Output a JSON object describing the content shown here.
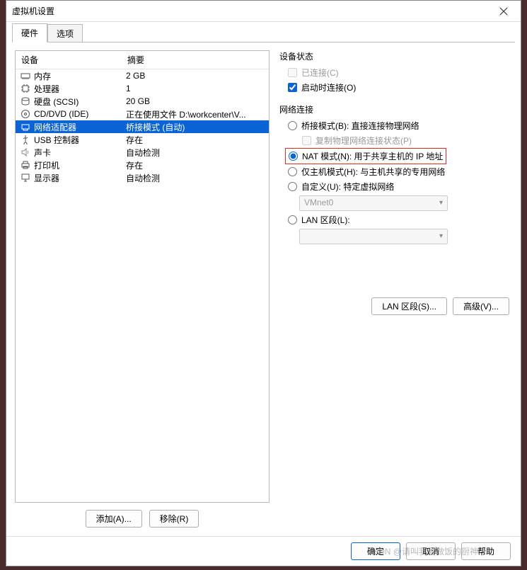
{
  "title": "虚拟机设置",
  "tabs": {
    "hardware": "硬件",
    "options": "选项"
  },
  "hw_header": {
    "device": "设备",
    "summary": "摘要"
  },
  "devices": [
    {
      "id": "memory",
      "label": "内存",
      "summary": "2 GB"
    },
    {
      "id": "cpu",
      "label": "处理器",
      "summary": "1"
    },
    {
      "id": "hdd",
      "label": "硬盘 (SCSI)",
      "summary": "20 GB"
    },
    {
      "id": "cdrom",
      "label": "CD/DVD (IDE)",
      "summary": "正在使用文件 D:\\workcenter\\V..."
    },
    {
      "id": "net",
      "label": "网络适配器",
      "summary": "桥接模式 (自动)"
    },
    {
      "id": "usb",
      "label": "USB 控制器",
      "summary": "存在"
    },
    {
      "id": "sound",
      "label": "声卡",
      "summary": "自动检测"
    },
    {
      "id": "printer",
      "label": "打印机",
      "summary": "存在"
    },
    {
      "id": "display",
      "label": "显示器",
      "summary": "自动检测"
    }
  ],
  "hw_buttons": {
    "add": "添加(A)...",
    "remove": "移除(R)"
  },
  "status": {
    "title": "设备状态",
    "connected": "已连接(C)",
    "connect_on_power": "启动时连接(O)"
  },
  "network": {
    "title": "网络连接",
    "bridged": "桥接模式(B): 直接连接物理网络",
    "replicate": "复制物理网络连接状态(P)",
    "nat": "NAT 模式(N): 用于共享主机的 IP 地址",
    "hostonly": "仅主机模式(H): 与主机共享的专用网络",
    "custom": "自定义(U): 特定虚拟网络",
    "vmnet": "VMnet0",
    "lan": "LAN 区段(L):"
  },
  "conn_buttons": {
    "lan": "LAN 区段(S)...",
    "advanced": "高级(V)..."
  },
  "footer": {
    "ok": "确定",
    "cancel": "取消",
    "help": "帮助"
  },
  "watermark": "CSDN @请叫我爱做饭的厨神"
}
